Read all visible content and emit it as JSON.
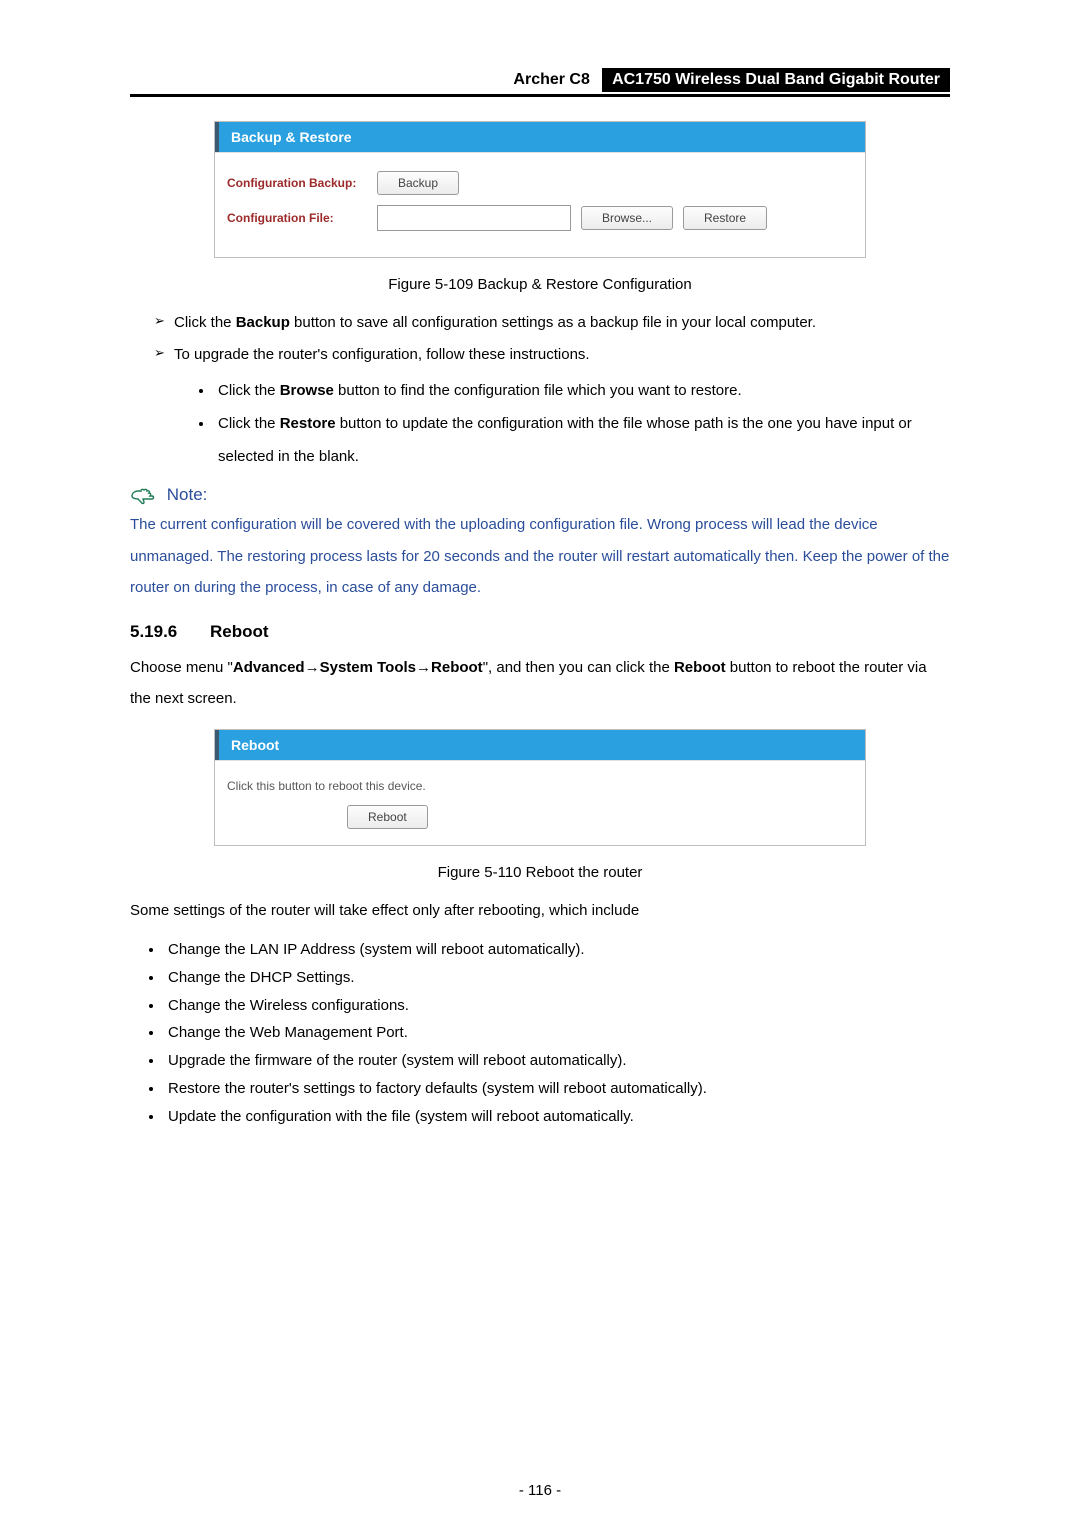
{
  "header": {
    "model": "Archer C8",
    "product": "AC1750 Wireless Dual Band Gigabit Router"
  },
  "backup_ui": {
    "title": "Backup & Restore",
    "config_backup_label": "Configuration Backup:",
    "backup_btn": "Backup",
    "config_file_label": "Configuration File:",
    "file_value": "",
    "browse_btn": "Browse...",
    "restore_btn": "Restore"
  },
  "fig1_caption": "Figure 5-109 Backup & Restore Configuration",
  "bullets": {
    "b1_pre": "Click the ",
    "b1_bold": "Backup",
    "b1_post": " button to save all configuration settings as a backup file in your local computer.",
    "b2": "To upgrade the router's configuration, follow these instructions.",
    "s1_pre": "Click the ",
    "s1_bold": "Browse",
    "s1_post": " button to find the configuration file which you want to restore.",
    "s2_pre": "Click the ",
    "s2_bold": "Restore",
    "s2_post": " button to update the configuration with the file whose path is the one you have input or selected in the blank."
  },
  "note": {
    "label": "Note:",
    "text": "The current configuration will be covered with the uploading configuration file. Wrong process will lead the device unmanaged. The restoring process lasts for 20 seconds and the router will restart automatically then. Keep the power of the router on during the process, in case of any damage."
  },
  "section": {
    "num": "5.19.6",
    "title": "Reboot"
  },
  "reboot_para": {
    "p1": "Choose menu \"",
    "p1b1": "Advanced",
    "arrow1": "→",
    "p1b2": "System Tools",
    "arrow2": "→",
    "p1b3": "Reboot",
    "p2": "\", and then you can click the ",
    "p2b": "Reboot",
    "p3": " button to reboot the router via the next screen."
  },
  "reboot_ui": {
    "title": "Reboot",
    "info": "Click this button to reboot this device.",
    "btn": "Reboot"
  },
  "fig2_caption": "Figure 5-110 Reboot the router",
  "after_reboot": "Some settings of the router will take effect only after rebooting, which include",
  "effects": [
    "Change the LAN IP Address (system will reboot automatically).",
    "Change the DHCP Settings.",
    "Change the Wireless configurations.",
    "Change the Web Management Port.",
    "Upgrade the firmware of the router (system will reboot automatically).",
    "Restore the router's settings to factory defaults (system will reboot automatically).",
    "Update the configuration with the file (system will reboot automatically."
  ],
  "page_number": "- 116 -"
}
